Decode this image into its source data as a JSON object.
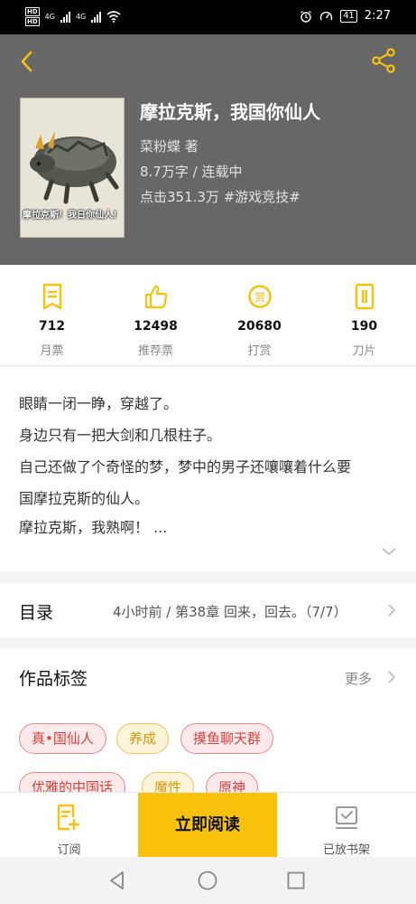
{
  "status_bar": {
    "hd_top": "HD",
    "hd_bottom": "HD",
    "network": "4G",
    "battery": "41",
    "time": "2:27"
  },
  "header": {
    "title": "摩拉克斯，我国你仙人",
    "author": "菜粉蝶  著",
    "stats": "8.7万字 / 连载中",
    "clicks": "点击351.3万  #游戏竞技#",
    "cover_caption": "摩拉克斯！我日你仙人！"
  },
  "metrics": [
    {
      "value": "712",
      "label": "月票",
      "icon": "monthly-ticket-icon"
    },
    {
      "value": "12498",
      "label": "推荐票",
      "icon": "thumbs-up-icon"
    },
    {
      "value": "20680",
      "label": "打赏",
      "icon": "reward-coin-icon"
    },
    {
      "value": "190",
      "label": "刀片",
      "icon": "blade-icon"
    }
  ],
  "synopsis": {
    "lines": [
      "眼睛一闭一睁，穿越了。",
      "身边只有一把大剑和几根柱子。",
      "自己还做了个奇怪的梦，梦中的男子还嚷嚷着什么要",
      "国摩拉克斯的仙人。",
      "摩拉克斯，我熟啊！ ..."
    ]
  },
  "toc": {
    "title": "目录",
    "latest": "4小时前 / 第38章 回来，回去。（7/7）"
  },
  "tags": {
    "title": "作品标签",
    "more": "更多",
    "items": [
      {
        "label": "真•国仙人",
        "style": "red"
      },
      {
        "label": "养成",
        "style": "yellow"
      },
      {
        "label": "摸鱼聊天群",
        "style": "red"
      },
      {
        "label": "优雅的中国话",
        "style": "red"
      },
      {
        "label": "魔性",
        "style": "yellow"
      },
      {
        "label": "原神",
        "style": "red"
      }
    ]
  },
  "actions": {
    "subscribe": "订阅",
    "read_now": "立即阅读",
    "shelf": "已放书架"
  },
  "colors": {
    "accent": "#f7c10c",
    "header_bg": "#676767",
    "tag_red": "#d8413f",
    "tag_yellow": "#d49a0a"
  }
}
